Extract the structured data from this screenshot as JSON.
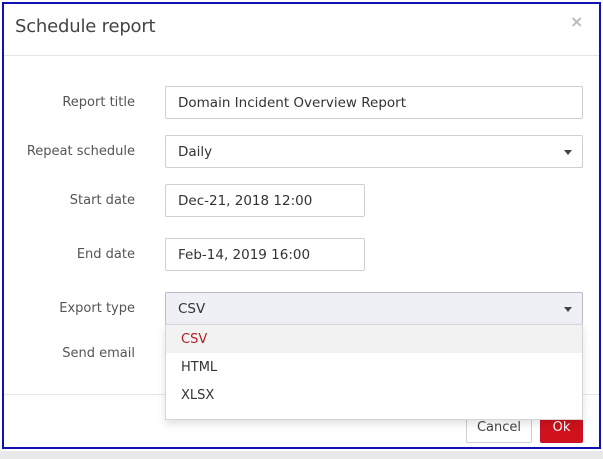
{
  "dialog": {
    "title": "Schedule report",
    "close_glyph": "×"
  },
  "form": {
    "report_title": {
      "label": "Report title",
      "value": "Domain Incident Overview Report"
    },
    "repeat_schedule": {
      "label": "Repeat schedule",
      "value": "Daily"
    },
    "start_date": {
      "label": "Start date",
      "value": "Dec-21, 2018 12:00"
    },
    "end_date": {
      "label": "End date",
      "value": "Feb-14, 2019 16:00"
    },
    "export_type": {
      "label": "Export type",
      "value": "CSV",
      "options": [
        "CSV",
        "HTML",
        "XLSX"
      ]
    },
    "send_email": {
      "label": "Send email"
    }
  },
  "footer": {
    "cancel_label": "Cancel",
    "ok_label": "Ok"
  },
  "colors": {
    "accent": "#d0121c",
    "selected_option_text": "#b01e24",
    "frame_border": "#1212b4"
  }
}
